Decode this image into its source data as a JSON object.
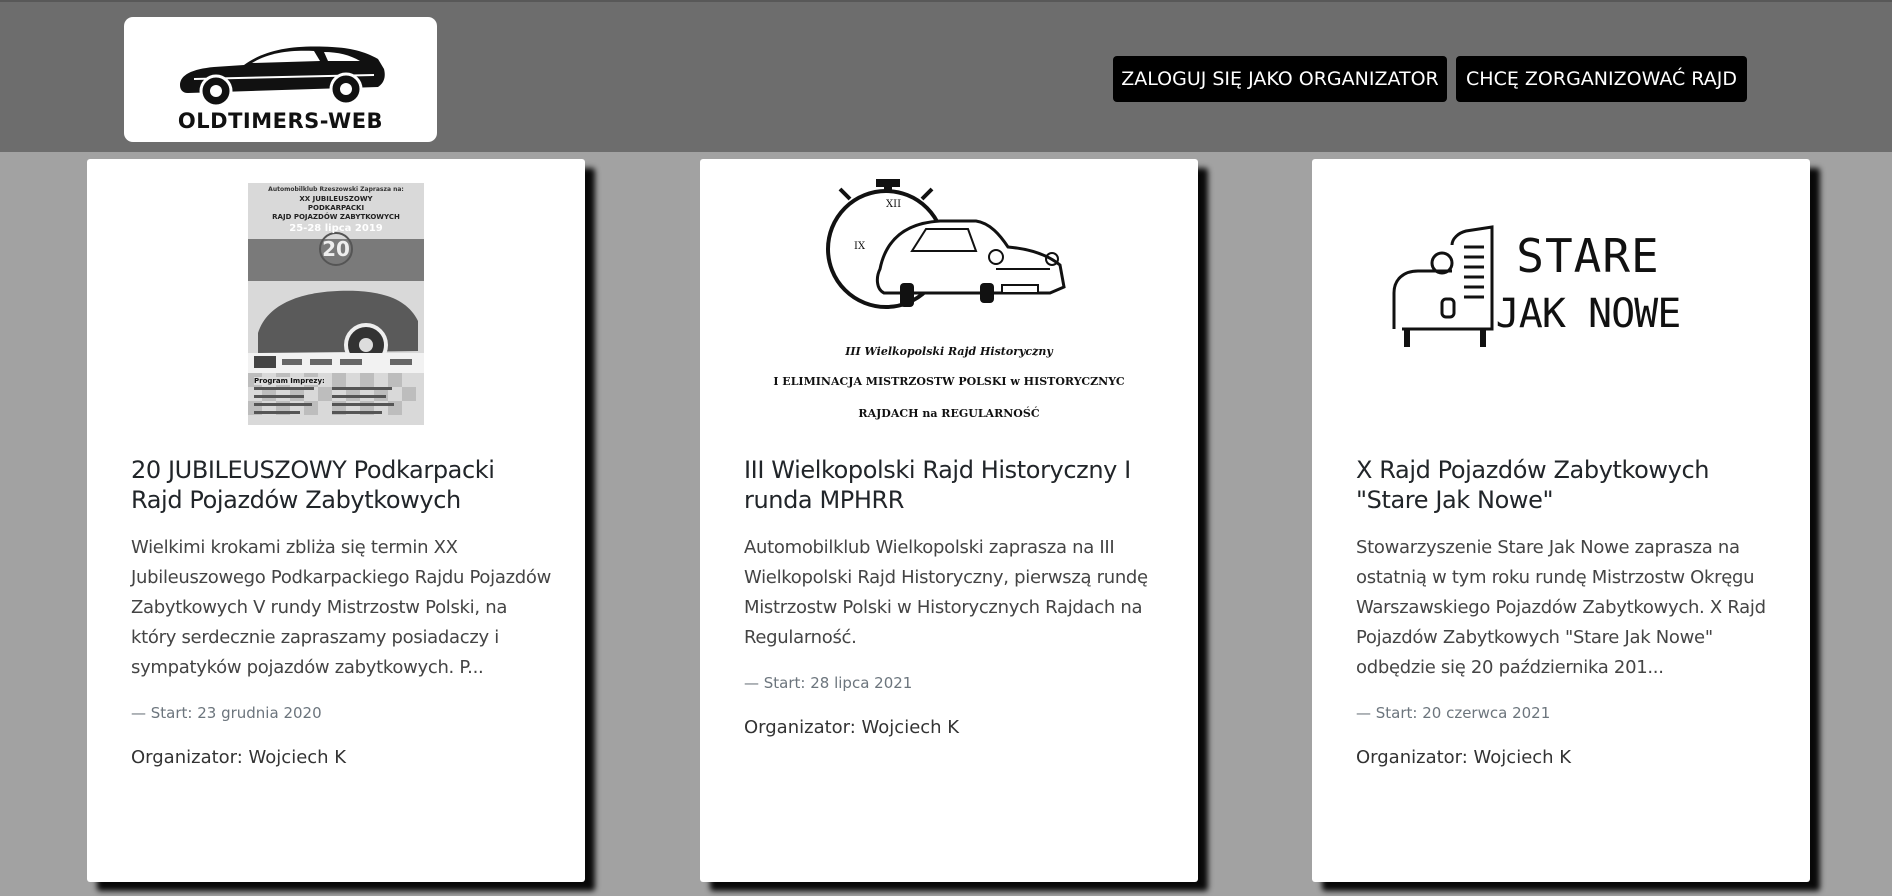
{
  "header": {
    "logo_text": "OLDTIMERS-WEB",
    "login_button": "ZALOGUJ SIĘ JAKO ORGANIZATOR",
    "organize_button": "CHCĘ ZORGANIZOWAĆ RAJD"
  },
  "colors": {
    "page_background": "#a2a2a2",
    "header_background": "#6d6d6d",
    "button_background": "#000000",
    "card_background": "#ffffff"
  },
  "cards": [
    {
      "poster": {
        "line1": "Automobilklub Rzeszowski Zaprasza na:",
        "line2": "XX JUBILEUSZOWY",
        "line3": "PODKARPACKI",
        "line4": "RAJD POJAZDÓW ZABYTKOWYCH",
        "line5": "25-28 lipca 2019",
        "number": "20",
        "program": "Program Imprezy:"
      },
      "title": "20 JUBILEUSZOWY Podkarpacki Rajd Pojazdów Zabytkowych",
      "description": "Wielkimi krokami zbliża się termin XX Jubileuszowego Podkarpackiego Rajdu Pojazdów Zabytkowych V rundy Mistrzostw Polski, na który serdecznie zapraszamy posiadaczy i sympatyków pojazdów zabytkowych. P...",
      "start": "— Start: 23 grudnia 2020",
      "organizer": "Organizator: Wojciech K"
    },
    {
      "image": {
        "clock_top": "XII",
        "clock_left": "IX",
        "line1": "III Wielkopolski Rajd Historyczny",
        "line2": "I ELIMINACJA MISTRZOSTW POLSKI w HISTORYCZNYC",
        "line3": "RAJDACH na REGULARNOŚĆ"
      },
      "title": "III Wielkopolski Rajd Historyczny I runda MPHRR",
      "description": "Automobilklub Wielkopolski zaprasza na III Wielkopolski Rajd Historyczny, pierwszą rundę Mistrzostw Polski w Historycznych Rajdach na Regularność.",
      "start": "— Start: 28 lipca 2021",
      "organizer": "Organizator: Wojciech K"
    },
    {
      "image": {
        "line1": "STARE",
        "line2": "JAK NOWE"
      },
      "title": "X Rajd Pojazdów Zabytkowych \"Stare Jak Nowe\"",
      "description": "Stowarzyszenie Stare Jak Nowe zaprasza na ostatnią w tym roku rundę Mistrzostw Okręgu Warszawskiego Pojazdów Zabytkowych. X Rajd Pojazdów Zabytkowych \"Stare Jak Nowe\" odbędzie się 20 października 201...",
      "start": "— Start: 20 czerwca 2021",
      "organizer": "Organizator: Wojciech K"
    }
  ]
}
